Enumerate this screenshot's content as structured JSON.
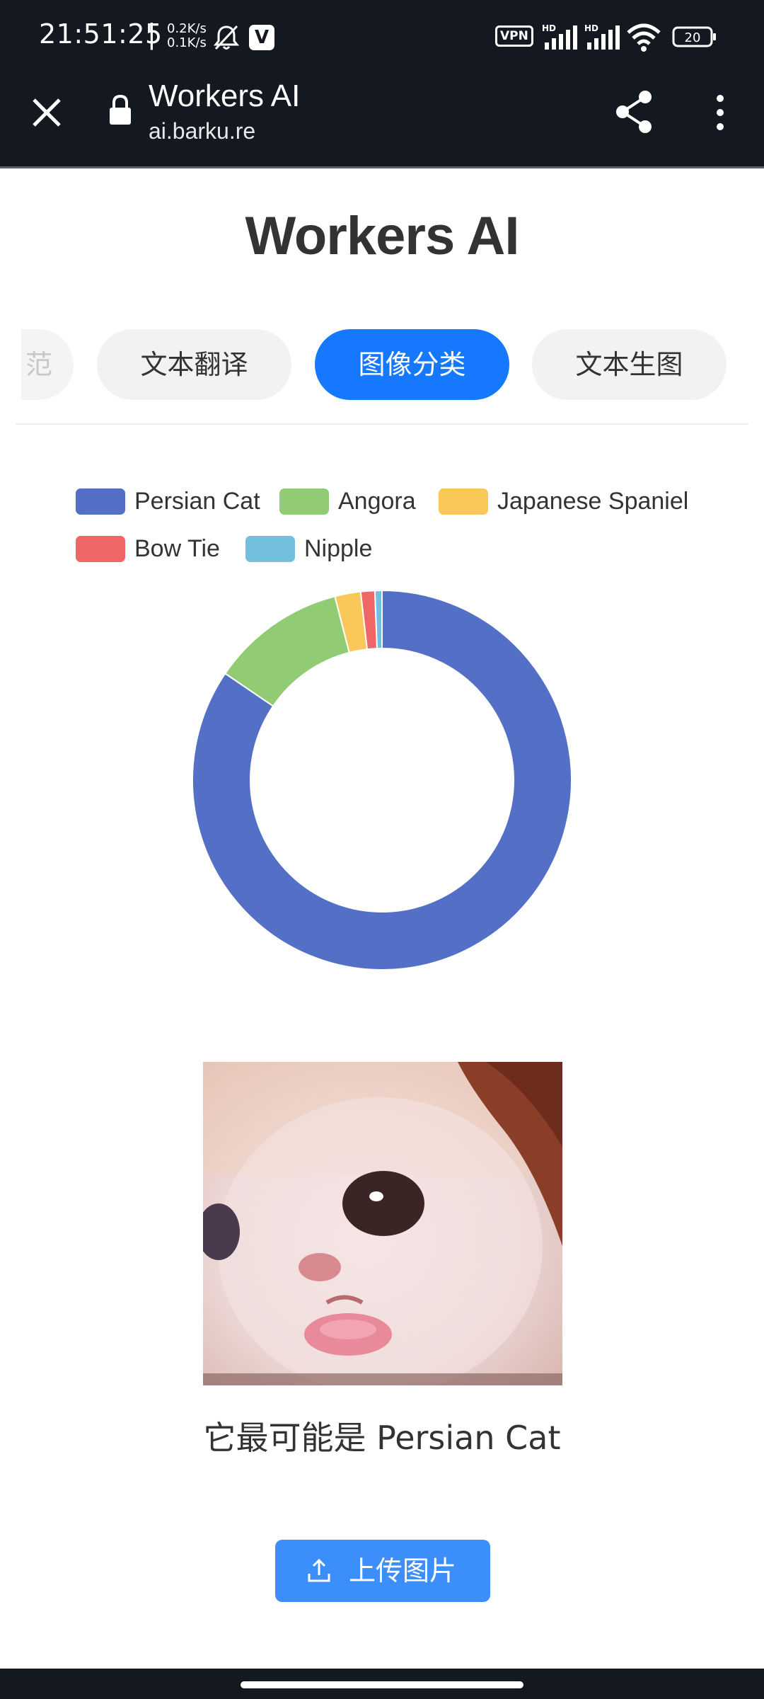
{
  "status_bar": {
    "time": "21:51:25",
    "separator": "|",
    "speed_up": "0.2K/s",
    "speed_down": "0.1K/s",
    "vpn": "VPN",
    "signal1_label": "HD",
    "signal2_label": "HD",
    "battery": "20"
  },
  "browser": {
    "title": "Workers AI",
    "url": "ai.barku.re"
  },
  "page": {
    "title": "Workers AI",
    "tabs": [
      {
        "label": "文本翻译",
        "active": false
      },
      {
        "label": "图像分类",
        "active": true
      },
      {
        "label": "文本生图",
        "active": false
      }
    ],
    "partial_tab_glyph": "范"
  },
  "chart_data": {
    "type": "pie",
    "donut": true,
    "legend_position": "top",
    "labels": [
      "Persian Cat",
      "Angora",
      "Japanese Spaniel",
      "Bow Tie",
      "Nipple"
    ],
    "values": [
      84.5,
      11.5,
      2.2,
      1.2,
      0.6
    ],
    "colors": [
      "#5470c6",
      "#91cc75",
      "#fac858",
      "#ee6666",
      "#73c0de"
    ]
  },
  "result_text": "它最可能是 Persian Cat",
  "upload_button": {
    "label": "上传图片"
  }
}
